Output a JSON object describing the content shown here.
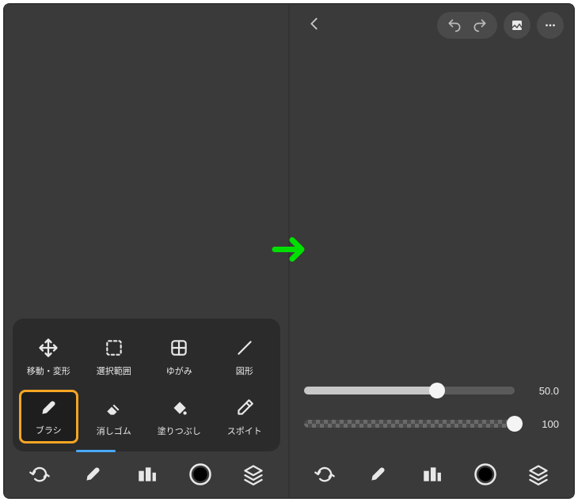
{
  "panel1": {
    "tools": [
      {
        "id": "move",
        "label": "移動・変形"
      },
      {
        "id": "select",
        "label": "選択範囲"
      },
      {
        "id": "distort",
        "label": "ゆがみ"
      },
      {
        "id": "shape",
        "label": "図形"
      },
      {
        "id": "brush",
        "label": "ブラシ",
        "selected": true
      },
      {
        "id": "eraser",
        "label": "消しゴム"
      },
      {
        "id": "fill",
        "label": "塗りつぶし"
      },
      {
        "id": "eyedropper",
        "label": "スポイト"
      }
    ],
    "bottomBar": {
      "items": [
        "rotate",
        "brush",
        "palette",
        "color",
        "layers"
      ]
    }
  },
  "panel2": {
    "topbar": {
      "back": true,
      "undo": true,
      "redo": true,
      "image": true,
      "more": true
    },
    "sliders": [
      {
        "id": "size",
        "value": "50.0",
        "percent": 63
      },
      {
        "id": "opacity",
        "value": "100",
        "percent": 100,
        "checker": true
      }
    ],
    "bottomBar": {
      "items": [
        "rotate",
        "brush",
        "palette",
        "color",
        "layers"
      ]
    }
  }
}
